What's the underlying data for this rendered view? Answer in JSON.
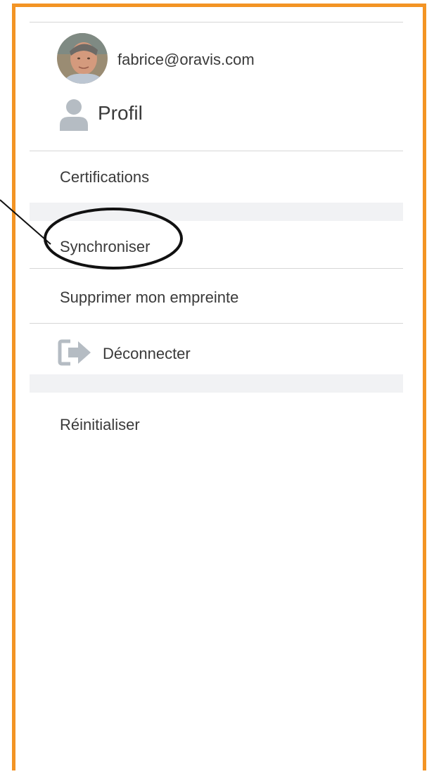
{
  "user": {
    "email": "fabrice@oravis.com"
  },
  "menu": {
    "profile_label": "Profil",
    "certifications_label": "Certifications",
    "sync_label": "Synchroniser",
    "delete_fingerprint_label": "Supprimer mon empreinte",
    "logout_label": "Déconnecter",
    "reset_label": "Réinitialiser"
  },
  "icons": {
    "profile": "person-icon",
    "logout": "logout-icon"
  },
  "colors": {
    "frame_border": "#f39424",
    "separator": "#d6d6d6",
    "section_gap": "#f1f2f4",
    "icon_gray": "#b5bcc3",
    "text": "#3a3a3a"
  }
}
